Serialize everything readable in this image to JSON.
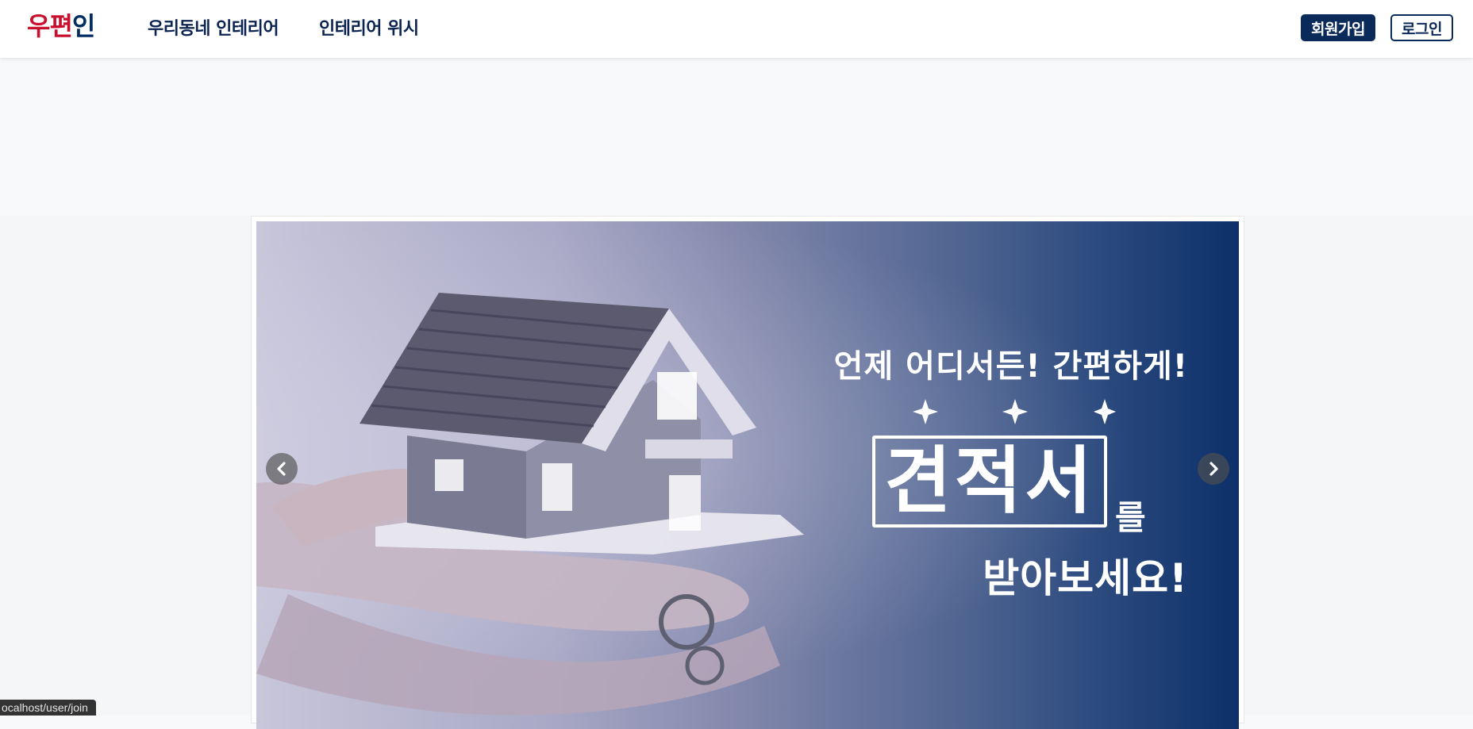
{
  "header": {
    "logo_part1": "우편",
    "logo_part2": "인",
    "nav": [
      "우리동네 인테리어",
      "인테리어 위시"
    ],
    "join_label": "회원가입",
    "login_label": "로그인"
  },
  "carousel": {
    "line1": "언제 어디서든! 간편하게!",
    "big_word": "견적서",
    "suffix": "를",
    "line3": "받아보세요!",
    "prev_icon": "chevron-left-icon",
    "next_icon": "chevron-right-icon"
  },
  "status_bar": {
    "url": "ocalhost/user/join"
  },
  "colors": {
    "brand_red": "#c8102e",
    "brand_navy": "#002d62",
    "button_navy": "#0a2a5a"
  }
}
